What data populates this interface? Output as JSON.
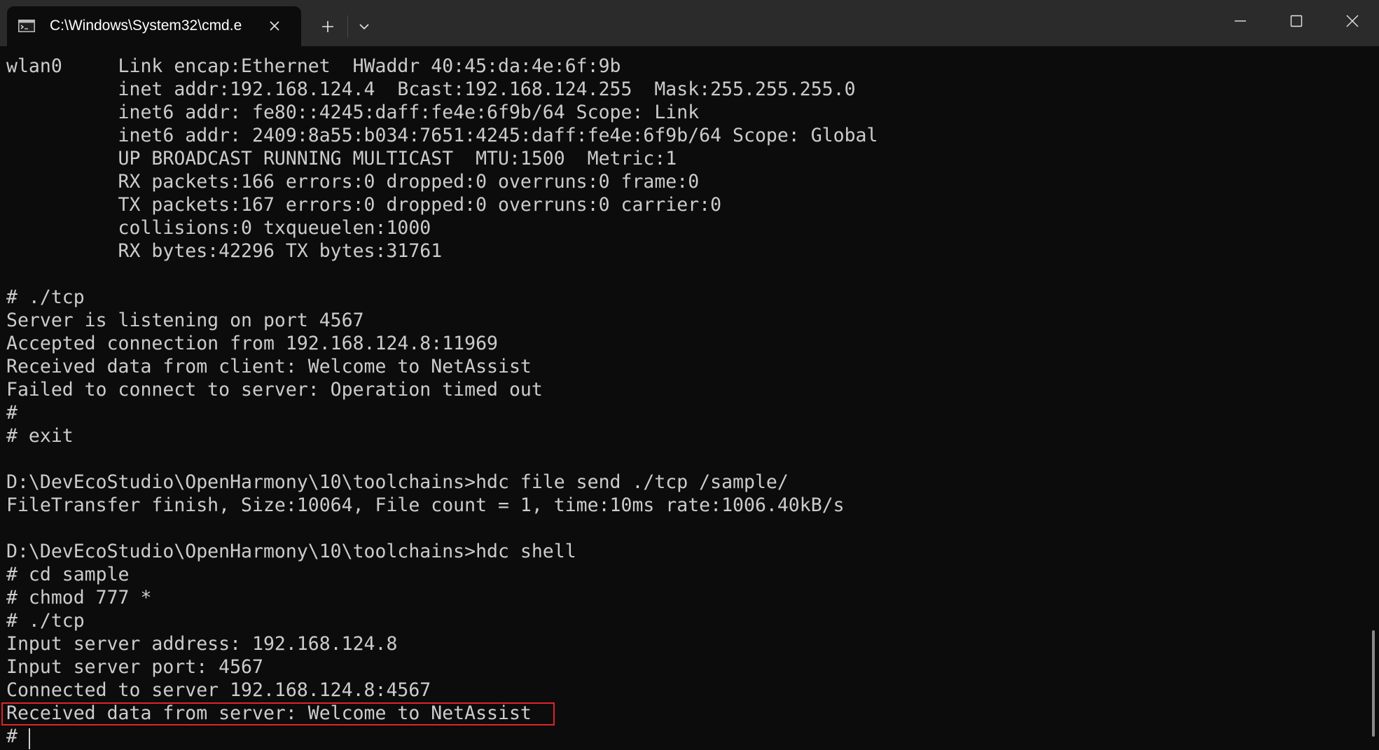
{
  "tab": {
    "title": "C:\\Windows\\System32\\cmd.e",
    "icon": "terminal-icon"
  },
  "titlebar_icons": {
    "close_tab": "close-icon",
    "new_tab": "plus-icon",
    "dropdown": "chevron-down-icon",
    "minimize": "minimize-icon",
    "maximize": "maximize-icon",
    "close_window": "close-icon"
  },
  "colors": {
    "background": "#0c0c0c",
    "titlebar": "#2b2b2b",
    "text": "#cccccc",
    "highlight_border": "#e0242a"
  },
  "console": {
    "lines": [
      "wlan0     Link encap:Ethernet  HWaddr 40:45:da:4e:6f:9b",
      "          inet addr:192.168.124.4  Bcast:192.168.124.255  Mask:255.255.255.0",
      "          inet6 addr: fe80::4245:daff:fe4e:6f9b/64 Scope: Link",
      "          inet6 addr: 2409:8a55:b034:7651:4245:daff:fe4e:6f9b/64 Scope: Global",
      "          UP BROADCAST RUNNING MULTICAST  MTU:1500  Metric:1",
      "          RX packets:166 errors:0 dropped:0 overruns:0 frame:0",
      "          TX packets:167 errors:0 dropped:0 overruns:0 carrier:0",
      "          collisions:0 txqueuelen:1000",
      "          RX bytes:42296 TX bytes:31761",
      "",
      "# ./tcp",
      "Server is listening on port 4567",
      "Accepted connection from 192.168.124.8:11969",
      "Received data from client: Welcome to NetAssist",
      "Failed to connect to server: Operation timed out",
      "#",
      "# exit",
      "",
      "D:\\DevEcoStudio\\OpenHarmony\\10\\toolchains>hdc file send ./tcp /sample/",
      "FileTransfer finish, Size:10064, File count = 1, time:10ms rate:1006.40kB/s",
      "",
      "D:\\DevEcoStudio\\OpenHarmony\\10\\toolchains>hdc shell",
      "# cd sample",
      "# chmod 777 *",
      "# ./tcp",
      "Input server address: 192.168.124.8",
      "Input server port: 4567",
      "Connected to server 192.168.124.8:4567",
      "Received data from server: Welcome to NetAssist",
      "# "
    ]
  }
}
